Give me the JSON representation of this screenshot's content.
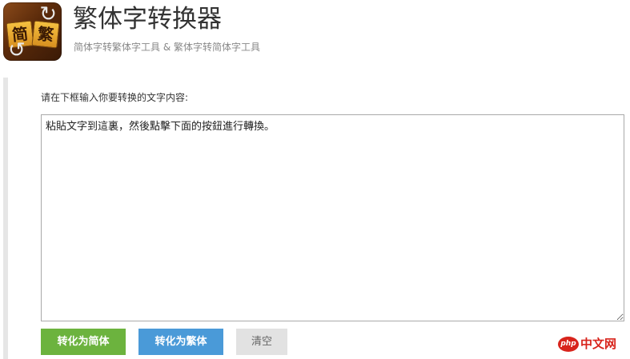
{
  "header": {
    "logo": {
      "left_char": "简",
      "right_char": "繁",
      "arrow_top": "↻",
      "arrow_bottom": "↺"
    },
    "title": "繁体字转换器",
    "subtitle": "简体字转繁体字工具 & 繁体字转简体字工具"
  },
  "main": {
    "instruction": "请在下框输入你要转换的文字内容:",
    "textarea_value": "粘貼文字到這裏，然後點擊下面的按鈕進行轉換。"
  },
  "buttons": {
    "to_simplified": "转化为简体",
    "to_traditional": "转化为繁体",
    "clear": "清空"
  },
  "watermark": {
    "badge": "php",
    "text": "中文网"
  },
  "colors": {
    "simplified_button": "#6cb33e",
    "traditional_button": "#4a9ad8",
    "clear_button": "#e2e2e2",
    "watermark": "#d8241c"
  }
}
